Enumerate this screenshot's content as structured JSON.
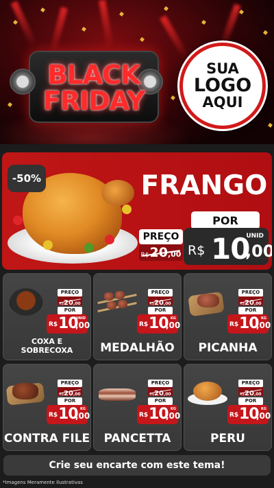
{
  "header": {
    "banner": {
      "line1": "BLACK",
      "line2": "FRIDAY"
    },
    "logo": {
      "line1": "SUA",
      "line2": "LOGO",
      "line3": "AQUI"
    }
  },
  "featured": {
    "discount": "-50%",
    "title": "FRANGO",
    "old_label": "PREÇO",
    "old_price": {
      "currency": "R$",
      "integer": "20",
      "decimal": ",00"
    },
    "new_label": "POR",
    "new_price": {
      "currency": "R$",
      "integer": "10",
      "decimal": ",00",
      "unit": "UNID"
    }
  },
  "products": [
    {
      "name": "COXA E\nSOBRECOXA",
      "old_label": "PREÇO",
      "old": {
        "currency": "R$",
        "integer": "20",
        "decimal": ",00"
      },
      "new_label": "POR",
      "price": {
        "currency": "R$",
        "integer": "10",
        "decimal": ",00",
        "unit": "UNID"
      }
    },
    {
      "name": "MEDALHÃO",
      "old_label": "PREÇO",
      "old": {
        "currency": "R$",
        "integer": "20",
        "decimal": ",00"
      },
      "new_label": "POR",
      "price": {
        "currency": "R$",
        "integer": "10",
        "decimal": ",00",
        "unit": "KG"
      }
    },
    {
      "name": "PICANHA",
      "old_label": "PREÇO",
      "old": {
        "currency": "R$",
        "integer": "20",
        "decimal": ",00"
      },
      "new_label": "POR",
      "price": {
        "currency": "R$",
        "integer": "10",
        "decimal": ",00",
        "unit": "KG"
      }
    },
    {
      "name": "CONTRA FILE",
      "old_label": "PREÇO",
      "old": {
        "currency": "R$",
        "integer": "20",
        "decimal": ",00"
      },
      "new_label": "POR",
      "price": {
        "currency": "R$",
        "integer": "10",
        "decimal": ",00",
        "unit": "KG"
      }
    },
    {
      "name": "PANCETTA",
      "old_label": "PREÇO",
      "old": {
        "currency": "R$",
        "integer": "20",
        "decimal": ",00"
      },
      "new_label": "POR",
      "price": {
        "currency": "R$",
        "integer": "10",
        "decimal": ",00",
        "unit": "KG"
      }
    },
    {
      "name": "PERU",
      "old_label": "PREÇO",
      "old": {
        "currency": "R$",
        "integer": "20",
        "decimal": ",00"
      },
      "new_label": "POR",
      "price": {
        "currency": "R$",
        "integer": "10",
        "decimal": ",00",
        "unit": "KG"
      }
    }
  ],
  "footer": {
    "cta": "Crie seu encarte com este tema!",
    "disclaimer": "*Imagens Meramente Ilustrativas"
  },
  "colors": {
    "accent_red": "#c4161b",
    "dark_red": "#8a0d10",
    "card_bg": "#404040",
    "page_bg": "#1c1c1c"
  },
  "icons": [
    "black-friday-megaphone-icon",
    "roast-chicken-image",
    "meat-product-image"
  ]
}
